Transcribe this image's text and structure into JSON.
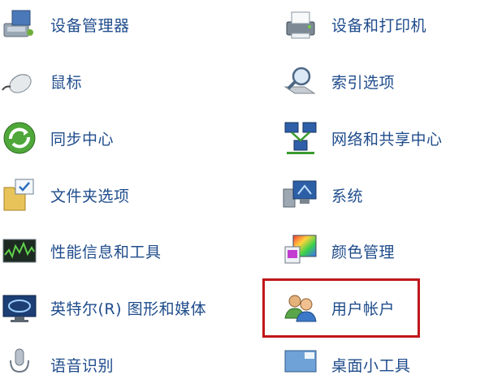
{
  "colors": {
    "link": "#1f4c8c",
    "highlight": "#c0171a"
  },
  "items_left": [
    {
      "label": "设备管理器",
      "icon": "device-manager-icon"
    },
    {
      "label": "鼠标",
      "icon": "mouse-icon"
    },
    {
      "label": "同步中心",
      "icon": "sync-center-icon"
    },
    {
      "label": "文件夹选项",
      "icon": "folder-options-icon"
    },
    {
      "label": "性能信息和工具",
      "icon": "performance-icon"
    },
    {
      "label": "英特尔(R) 图形和媒体",
      "icon": "intel-graphics-icon"
    },
    {
      "label": "语音识别",
      "icon": "speech-recognition-icon"
    }
  ],
  "items_right": [
    {
      "label": "设备和打印机",
      "icon": "printer-icon"
    },
    {
      "label": "索引选项",
      "icon": "indexing-options-icon"
    },
    {
      "label": "网络和共享中心",
      "icon": "network-sharing-icon"
    },
    {
      "label": "系统",
      "icon": "system-icon"
    },
    {
      "label": "颜色管理",
      "icon": "color-management-icon"
    },
    {
      "label": "用户帐户",
      "icon": "user-accounts-icon"
    },
    {
      "label": "桌面小工具",
      "icon": "desktop-gadgets-icon"
    }
  ]
}
